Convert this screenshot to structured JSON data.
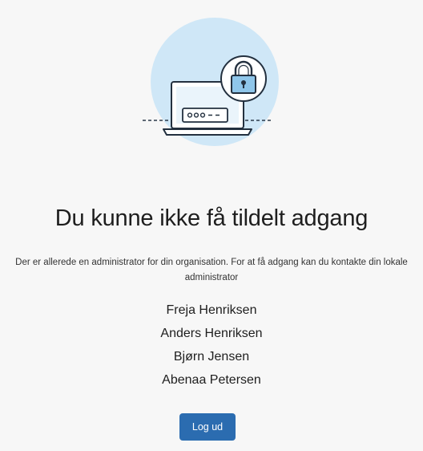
{
  "page": {
    "title": "Du kunne ikke få tildelt adgang",
    "message": "Der er allerede en administrator for din organisation. For at få adgang kan du kontakte din lokale administrator"
  },
  "administrators": [
    "Freja Henriksen",
    "Anders Henriksen",
    "Bjørn Jensen",
    "Abenaa Petersen"
  ],
  "actions": {
    "logout_label": "Log ud"
  },
  "illustration": {
    "icons": [
      "laptop-icon",
      "lock-icon",
      "password-field-icon"
    ],
    "password_mask": "●●●--"
  },
  "colors": {
    "accent": "#2b6cb0",
    "illustration_blue": "#d3e9f8",
    "illustration_dark": "#23303f",
    "background": "#f7f7f7"
  }
}
